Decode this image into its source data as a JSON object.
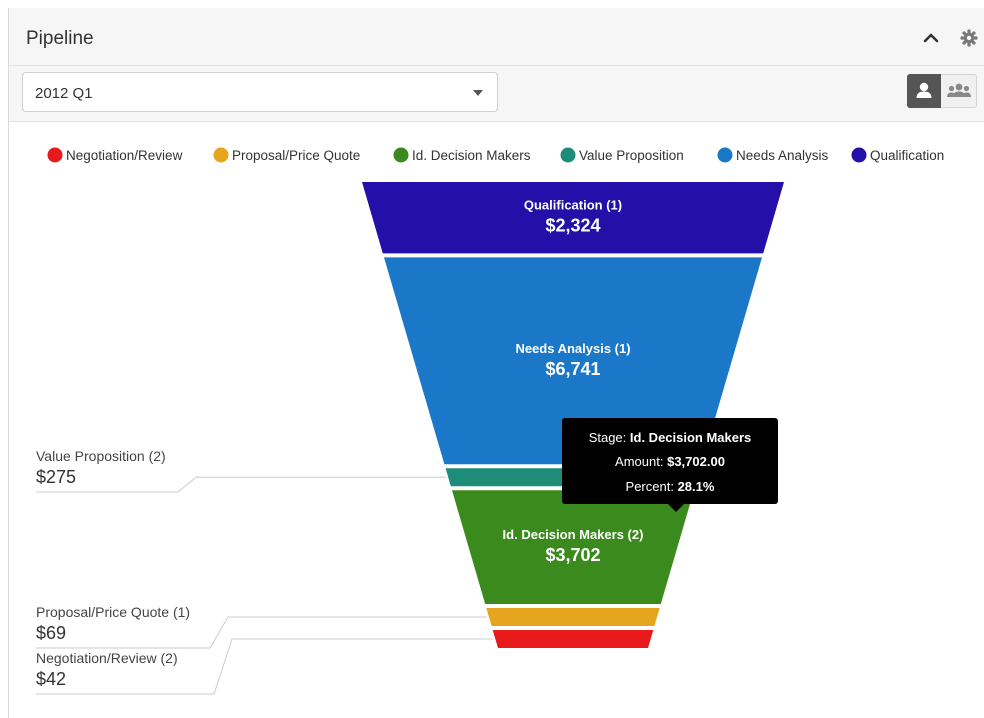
{
  "panel": {
    "title": "Pipeline",
    "period": {
      "selected": "2012 Q1"
    },
    "icons": {
      "collapse": "chevron-up-icon",
      "settings": "gear-icon",
      "caret": "caret-down-icon",
      "user_view": "user-icon",
      "group_view": "group-icon"
    }
  },
  "tooltip": {
    "stage_label": "Stage:",
    "stage_value": "Id. Decision Makers",
    "amount_label": "Amount:",
    "amount_value": "$3,702.00",
    "percent_label": "Percent:",
    "percent_value": "28.1%"
  },
  "chart_data": {
    "type": "funnel",
    "legend_position": "top",
    "legend": [
      {
        "name": "Negotiation/Review",
        "color": "#e8191a"
      },
      {
        "name": "Proposal/Price Quote",
        "color": "#e6a51f"
      },
      {
        "name": "Id. Decision Makers",
        "color": "#3a8a1d"
      },
      {
        "name": "Value Proposition",
        "color": "#1d8c78"
      },
      {
        "name": "Needs Analysis",
        "color": "#1b78c8"
      },
      {
        "name": "Qualification",
        "color": "#2410a8"
      }
    ],
    "stages": [
      {
        "name": "Qualification",
        "count": 1,
        "value": 2324,
        "label": "Qualification (1)",
        "value_label": "$2,324",
        "color": "#2410a8"
      },
      {
        "name": "Needs Analysis",
        "count": 1,
        "value": 6741,
        "label": "Needs Analysis (1)",
        "value_label": "$6,741",
        "color": "#1b78c8"
      },
      {
        "name": "Value Proposition",
        "count": 2,
        "value": 275,
        "label": "Value Proposition (2)",
        "value_label": "$275",
        "color": "#1d8c78"
      },
      {
        "name": "Id. Decision Makers",
        "count": 2,
        "value": 3702,
        "label": "Id. Decision Makers (2)",
        "value_label": "$3,702",
        "color": "#3a8a1d"
      },
      {
        "name": "Proposal/Price Quote",
        "count": 1,
        "value": 69,
        "label": "Proposal/Price Quote (1)",
        "value_label": "$69",
        "color": "#e6a51f"
      },
      {
        "name": "Negotiation/Review",
        "count": 2,
        "value": 42,
        "label": "Negotiation/Review (2)",
        "value_label": "$42",
        "color": "#e8191a"
      }
    ]
  }
}
